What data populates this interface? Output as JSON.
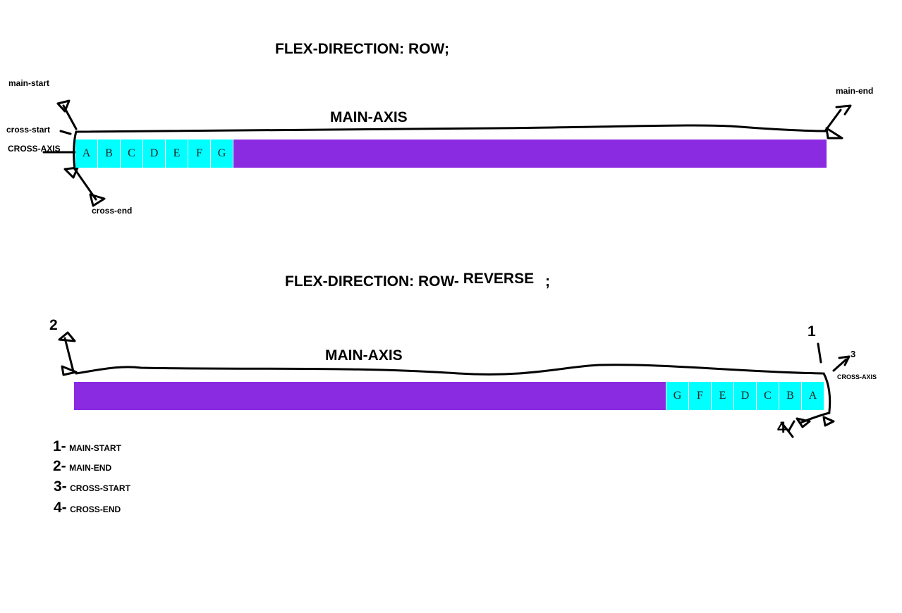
{
  "diagram1": {
    "title_prefix": "FLEX-DIRECTION:",
    "title_value": "ROW;",
    "axis_title": "MAIN-AXIS",
    "labels": {
      "main_start": "main-start",
      "main_end": "main-end",
      "cross_start": "cross-start",
      "cross_axis": "CROSS-AXIS",
      "cross_end": "cross-end"
    },
    "items": [
      "A",
      "B",
      "C",
      "D",
      "E",
      "F",
      "G"
    ],
    "colors": {
      "container": "#8a2be2",
      "item": "#00ffff"
    }
  },
  "diagram2": {
    "title_prefix": "FLEX-DIRECTION: ROW-",
    "title_value": "REVERSE",
    "title_suffix": ";",
    "axis_title": "MAIN-AXIS",
    "cross_axis": "CROSS-AXIS",
    "markers": {
      "m1": "1",
      "m2": "2",
      "m3": "3",
      "m4": "4"
    },
    "items": [
      "A",
      "B",
      "C",
      "D",
      "E",
      "F",
      "G"
    ],
    "colors": {
      "container": "#8a2be2",
      "item": "#00ffff"
    }
  },
  "legend": [
    {
      "num": "1-",
      "label": "MAIN-START"
    },
    {
      "num": "2-",
      "label": "MAIN-END"
    },
    {
      "num": "3-",
      "label": "CROSS-START"
    },
    {
      "num": "4-",
      "label": "CROSS-END"
    }
  ]
}
